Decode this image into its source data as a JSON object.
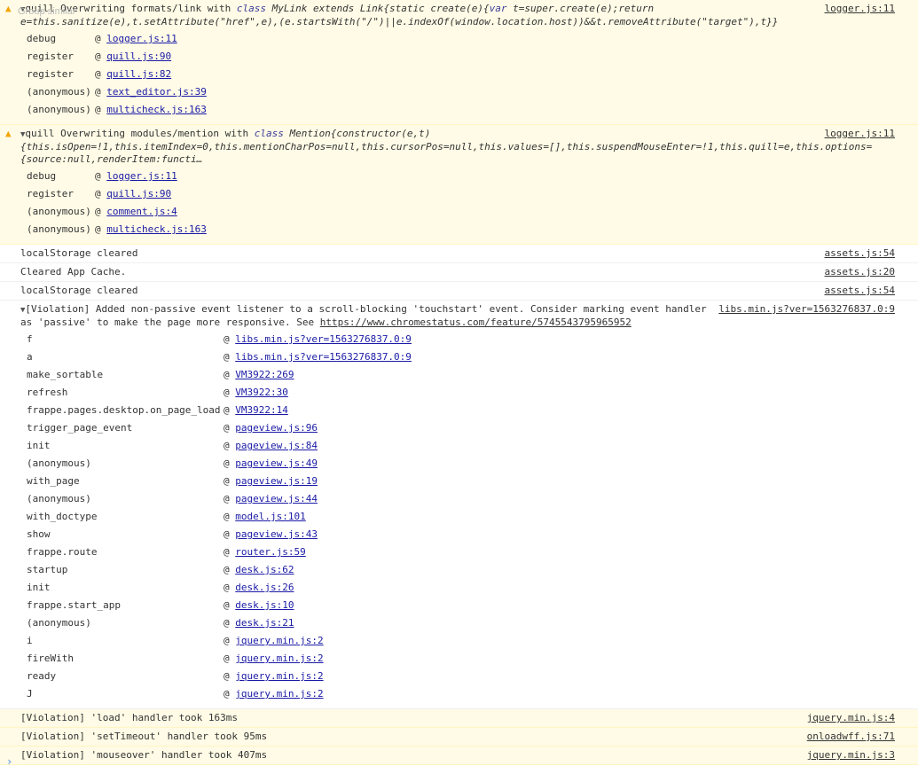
{
  "tooltip": "Group similar",
  "msg1": {
    "line1_pre": "quill Overwriting formats/link with ",
    "kw_class": "class",
    "line1_mid": " MyLink extends Link{static create(e){",
    "kw_var": "var",
    "line1_post": " t=super.create(e);return",
    "line2": "e=this.sanitize(e),t.setAttribute(\"href\",e),(e.startsWith(\"/\")||e.indexOf(window.location.host))&&t.removeAttribute(\"target\"),t}}",
    "source": "logger.js:11",
    "stack": [
      {
        "fn": "debug",
        "loc": "logger.js:11"
      },
      {
        "fn": "register",
        "loc": "quill.js:90"
      },
      {
        "fn": "register",
        "loc": "quill.js:82"
      },
      {
        "fn": "(anonymous)",
        "loc": "text_editor.js:39"
      },
      {
        "fn": "(anonymous)",
        "loc": "multicheck.js:163"
      }
    ]
  },
  "msg2": {
    "line1_pre": "quill Overwriting modules/mention with ",
    "kw_class": "class",
    "line1_post": " Mention{constructor(e,t)",
    "line2": "{this.isOpen=!1,this.itemIndex=0,this.mentionCharPos=null,this.cursorPos=null,this.values=[],this.suspendMouseEnter=!1,this.quill=e,this.options=",
    "line3": "{source:null,renderItem:functi…",
    "source": "logger.js:11",
    "stack": [
      {
        "fn": "debug",
        "loc": "logger.js:11"
      },
      {
        "fn": "register",
        "loc": "quill.js:90"
      },
      {
        "fn": "(anonymous)",
        "loc": "comment.js:4"
      },
      {
        "fn": "(anonymous)",
        "loc": "multicheck.js:163"
      }
    ]
  },
  "logs": [
    {
      "text": "localStorage cleared",
      "source": "assets.js:54"
    },
    {
      "text": "Cleared App Cache.",
      "source": "assets.js:20"
    },
    {
      "text": "localStorage cleared",
      "source": "assets.js:54"
    }
  ],
  "violation": {
    "line1": "[Violation] Added non-passive event listener to a scroll-blocking 'touchstart' event. Consider marking event handler",
    "line2_pre": "as 'passive' to make the page more responsive. See ",
    "url": "https://www.chromestatus.com/feature/5745543795965952",
    "source": "libs.min.js?ver=1563276837.0:9",
    "stack": [
      {
        "fn": "f",
        "loc": "libs.min.js?ver=1563276837.0:9"
      },
      {
        "fn": "a",
        "loc": "libs.min.js?ver=1563276837.0:9"
      },
      {
        "fn": "make_sortable",
        "loc": "VM3922:269"
      },
      {
        "fn": "refresh",
        "loc": "VM3922:30"
      },
      {
        "fn": "frappe.pages.desktop.on_page_load",
        "loc": "VM3922:14"
      },
      {
        "fn": "trigger_page_event",
        "loc": "pageview.js:96"
      },
      {
        "fn": "init",
        "loc": "pageview.js:84"
      },
      {
        "fn": "(anonymous)",
        "loc": "pageview.js:49"
      },
      {
        "fn": "with_page",
        "loc": "pageview.js:19"
      },
      {
        "fn": "(anonymous)",
        "loc": "pageview.js:44"
      },
      {
        "fn": "with_doctype",
        "loc": "model.js:101"
      },
      {
        "fn": "show",
        "loc": "pageview.js:43"
      },
      {
        "fn": "frappe.route",
        "loc": "router.js:59"
      },
      {
        "fn": "startup",
        "loc": "desk.js:62"
      },
      {
        "fn": "init",
        "loc": "desk.js:26"
      },
      {
        "fn": "frappe.start_app",
        "loc": "desk.js:10"
      },
      {
        "fn": "(anonymous)",
        "loc": "desk.js:21"
      },
      {
        "fn": "i",
        "loc": "jquery.min.js:2"
      },
      {
        "fn": "fireWith",
        "loc": "jquery.min.js:2"
      },
      {
        "fn": "ready",
        "loc": "jquery.min.js:2"
      },
      {
        "fn": "J",
        "loc": "jquery.min.js:2"
      }
    ]
  },
  "violations": [
    {
      "text": "[Violation] 'load' handler took 163ms",
      "source": "jquery.min.js:4"
    },
    {
      "text": "[Violation] 'setTimeout' handler took 95ms",
      "source": "onloadwff.js:71"
    },
    {
      "text": "[Violation] 'mouseover' handler took 407ms",
      "source": "jquery.min.js:3"
    }
  ],
  "prompt_symbol": "›",
  "icons": {
    "warning": "warning-icon",
    "triangle": "expand-triangle-icon",
    "prompt": "console-prompt-icon"
  },
  "colors": {
    "warn_bg": "#fffbe6",
    "warn_icon": "#f5a400",
    "link": "#1a1aa6"
  }
}
